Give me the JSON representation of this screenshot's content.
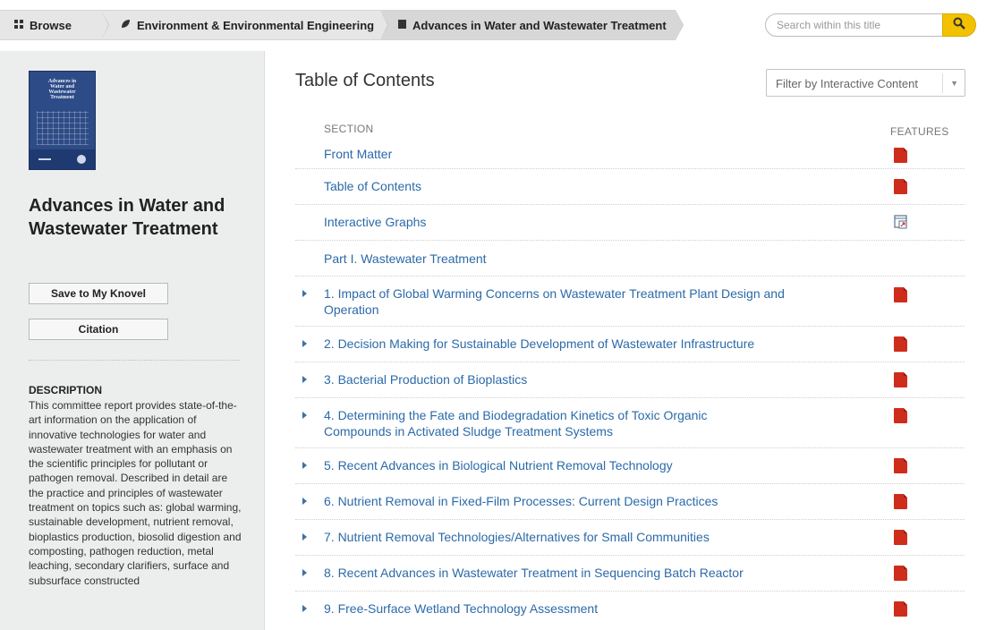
{
  "breadcrumb": {
    "items": [
      {
        "label": "Browse",
        "icon": "grid-icon"
      },
      {
        "label": "Environment & Environmental Engineering",
        "icon": "leaf-icon"
      },
      {
        "label": "Advances in Water and Wastewater Treatment",
        "icon": "book-icon"
      }
    ]
  },
  "search": {
    "placeholder": "Search within this title",
    "button_icon": "search-icon",
    "button_color": "#f2c200"
  },
  "sidebar": {
    "cover_text": [
      "Advances in",
      "Water and",
      "Wastewater",
      "Treatment"
    ],
    "title": "Advances in Water and Wastewater Treatment",
    "save_label": "Save to My Knovel",
    "citation_label": "Citation",
    "description_heading": "DESCRIPTION",
    "description": "This committee report provides state-of-the-art information on the application of innovative technologies for water and wastewater treatment with an emphasis on the scientific principles for pollutant or pathogen removal. Described in detail are the practice and principles of wastewater treatment on topics such as: global warming, sustainable development, nutrient removal, bioplastics production, biosolid digestion and composting, pathogen reduction, metal leaching, secondary clarifiers, surface and subsurface constructed"
  },
  "main": {
    "title": "Table of Contents",
    "filter_label": "Filter by Interactive Content",
    "col_section": "SECTION",
    "col_features": "FEATURES",
    "link_color": "#2b6aa8",
    "rows": [
      {
        "label": "Front Matter",
        "expandable": false,
        "feature": "pdf-icon"
      },
      {
        "label": "Table of Contents",
        "expandable": false,
        "feature": "pdf-icon"
      },
      {
        "label": "Interactive Graphs",
        "expandable": false,
        "feature": "interactive-graph-icon"
      },
      {
        "label": "Part I. Wastewater Treatment",
        "expandable": false,
        "feature": ""
      },
      {
        "label": "1. Impact of Global Warming Concerns on Wastewater Treatment Plant Design and Operation",
        "expandable": true,
        "feature": "pdf-icon"
      },
      {
        "label": "2. Decision Making for Sustainable Development of Wastewater Infrastructure",
        "expandable": true,
        "feature": "pdf-icon"
      },
      {
        "label": "3. Bacterial Production of Bioplastics",
        "expandable": true,
        "feature": "pdf-icon"
      },
      {
        "label": "4. Determining the Fate and Biodegradation Kinetics of Toxic Organic Compounds in Activated Sludge Treatment Systems",
        "expandable": true,
        "feature": "pdf-icon"
      },
      {
        "label": "5. Recent Advances in Biological Nutrient Removal Technology",
        "expandable": true,
        "feature": "pdf-icon"
      },
      {
        "label": "6. Nutrient Removal in Fixed-Film Processes: Current Design Practices",
        "expandable": true,
        "feature": "pdf-icon"
      },
      {
        "label": "7. Nutrient Removal Technologies/Alternatives for Small Communities",
        "expandable": true,
        "feature": "pdf-icon"
      },
      {
        "label": "8. Recent Advances in Wastewater Treatment in Sequencing Batch Reactor",
        "expandable": true,
        "feature": "pdf-icon"
      },
      {
        "label": "9. Free-Surface Wetland Technology Assessment",
        "expandable": true,
        "feature": "pdf-icon"
      }
    ]
  }
}
